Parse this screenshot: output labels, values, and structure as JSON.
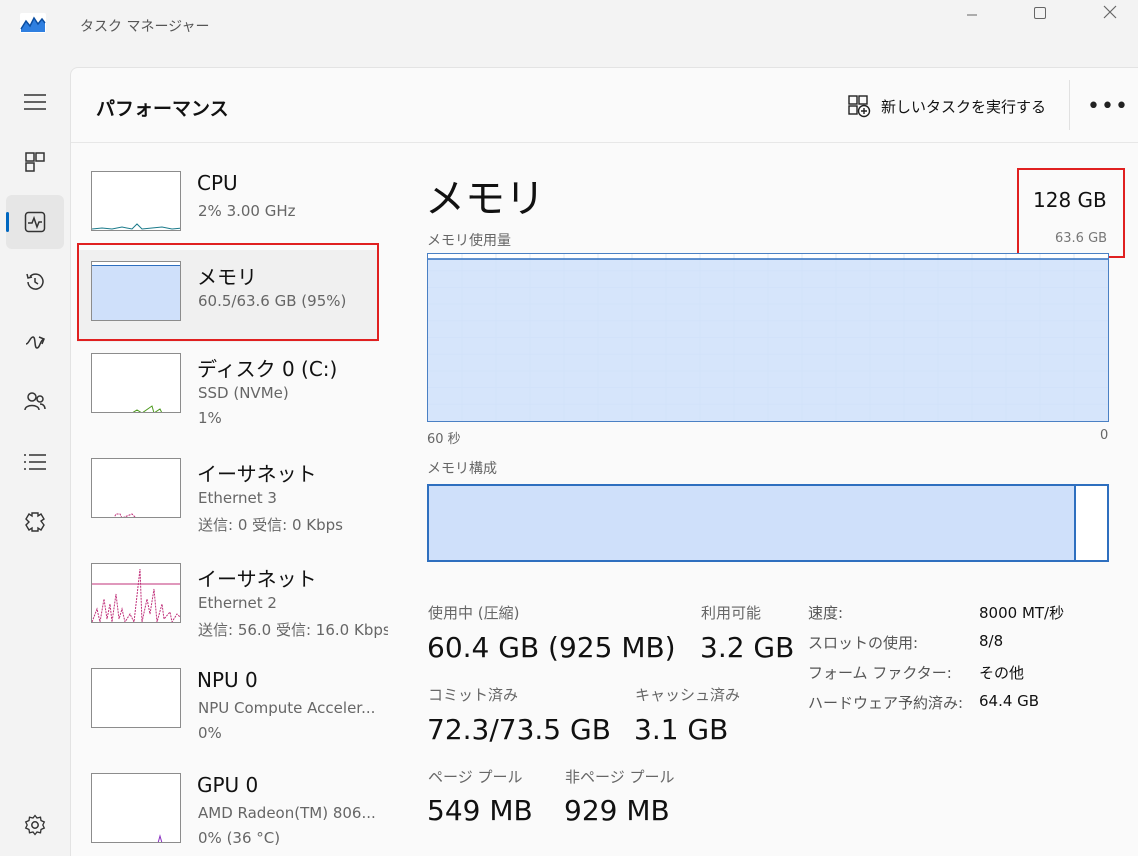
{
  "window": {
    "title": "タスク マネージャー",
    "icon": "task-manager-icon"
  },
  "nav": {
    "items": [
      {
        "name": "hamburger-menu-icon"
      },
      {
        "name": "processes-icon"
      },
      {
        "name": "performance-icon",
        "active": true
      },
      {
        "name": "app-history-icon"
      },
      {
        "name": "startup-apps-icon"
      },
      {
        "name": "users-icon"
      },
      {
        "name": "details-icon"
      },
      {
        "name": "services-icon"
      }
    ],
    "settings_icon": "settings-icon"
  },
  "header": {
    "title": "パフォーマンス",
    "new_task_label": "新しいタスクを実行する",
    "more_label": "•••"
  },
  "devices": [
    {
      "name": "CPU",
      "sub1": "2%  3.00 GHz",
      "sub2": ""
    },
    {
      "name": "メモリ",
      "sub1": "60.5/63.6 GB (95%)",
      "sub2": "",
      "selected": true
    },
    {
      "name": "ディスク 0 (C:)",
      "sub1": "SSD (NVMe)",
      "sub2": "1%"
    },
    {
      "name": "イーサネット",
      "sub1": "Ethernet 3",
      "sub2": "送信: 0  受信: 0 Kbps"
    },
    {
      "name": "イーサネット",
      "sub1": "Ethernet 2",
      "sub2": "送信: 56.0  受信: 16.0 Kbps"
    },
    {
      "name": "NPU 0",
      "sub1": "NPU Compute Acceler...",
      "sub2": "0%"
    },
    {
      "name": "GPU 0",
      "sub1": "AMD Radeon(TM) 806...",
      "sub2": "0%  (36 °C)"
    }
  ],
  "detail": {
    "title": "メモリ",
    "total": "128 GB",
    "sub_total": "63.6 GB",
    "usage_label": "メモリ使用量",
    "axis_left": "60 秒",
    "axis_right": "0",
    "usage_fraction": 0.97,
    "composition_label": "メモリ構成",
    "composition_fraction": 0.955,
    "stats": {
      "in_use_label": "使用中 (圧縮)",
      "in_use_value": "60.4 GB (925 MB)",
      "available_label": "利用可能",
      "available_value": "3.2 GB",
      "committed_label": "コミット済み",
      "committed_value": "72.3/73.5 GB",
      "cached_label": "キャッシュ済み",
      "cached_value": "3.1 GB",
      "paged_label": "ページ プール",
      "paged_value": "549 MB",
      "nonpaged_label": "非ページ プール",
      "nonpaged_value": "929 MB"
    },
    "specs": [
      {
        "k": "速度:",
        "v": "8000 MT/秒"
      },
      {
        "k": "スロットの使用:",
        "v": "8/8"
      },
      {
        "k": "フォーム ファクター:",
        "v": "その他"
      },
      {
        "k": "ハードウェア予約済み:",
        "v": "64.4 GB"
      }
    ]
  },
  "colors": {
    "accent": "#0067c0",
    "memory_fill": "#cfe0fa",
    "memory_line": "#2e6fbf",
    "highlight": "#e02020",
    "cpu_line": "#1a7a8a",
    "disk_line": "#4d9a1e",
    "net_line": "#c0307a",
    "gpu_line": "#8a30c0"
  }
}
